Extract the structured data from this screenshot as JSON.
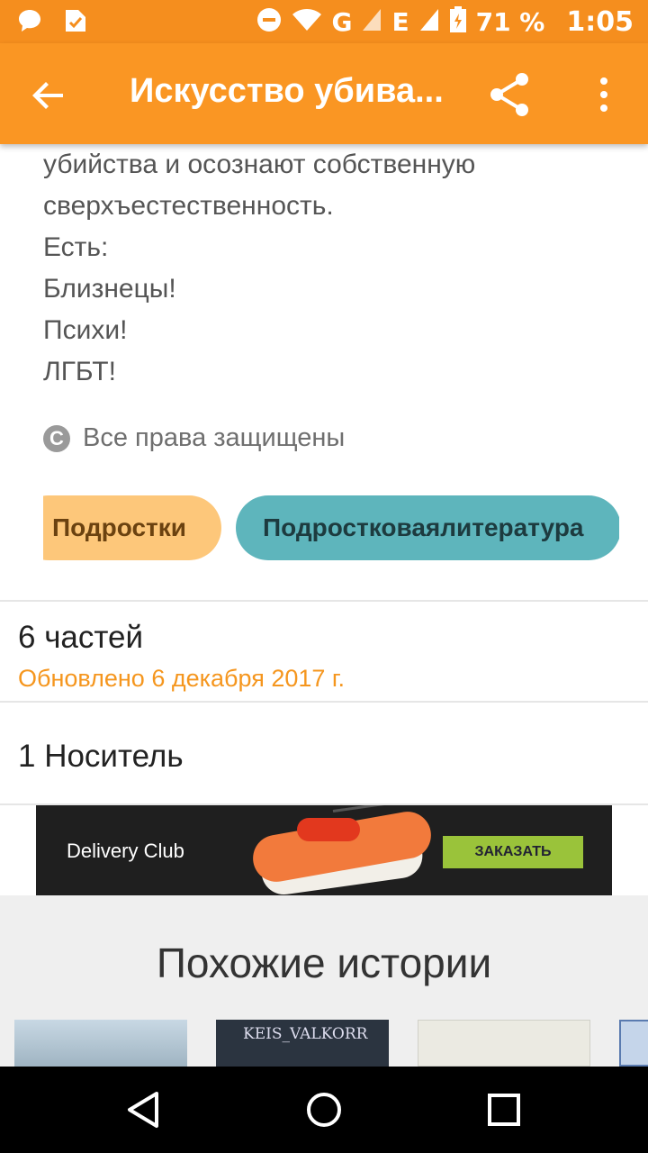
{
  "status_bar": {
    "battery_percent": "71 %",
    "time": "1:05",
    "network": "G",
    "network2": "E"
  },
  "app_bar": {
    "title": "Искусство убива...",
    "icons": [
      "back-arrow-icon",
      "share-icon",
      "more-vert-icon"
    ]
  },
  "description": {
    "lines": [
      "убийства и осознают собственную",
      "сверхъестественность.",
      "Есть:",
      "Близнецы!",
      "Психи!",
      "ЛГБТ!"
    ]
  },
  "copyright": {
    "icon": "copyright-icon",
    "label": "Все права защищены"
  },
  "tags": [
    {
      "label": "Подростки",
      "color": "#fdc77a"
    },
    {
      "label": "Подростковаялитература",
      "color": "#5eb5bc"
    }
  ],
  "parts": {
    "count": "6 частей",
    "updated": "Обновлено 6 декабря 2017 г."
  },
  "media": {
    "label": "1 Носитель"
  },
  "ad": {
    "brand": "Delivery Club",
    "button": "ЗАКАЗАТЬ"
  },
  "similar": {
    "heading": "Похожие истории",
    "thumbs": [
      {
        "caption": ""
      },
      {
        "caption": "KEIS_VALKORR"
      },
      {
        "caption": ""
      },
      {
        "caption": ""
      }
    ]
  },
  "colors": {
    "status_bar": "#f58e1e",
    "app_bar": "#fa9623",
    "accent": "#f5961e"
  }
}
